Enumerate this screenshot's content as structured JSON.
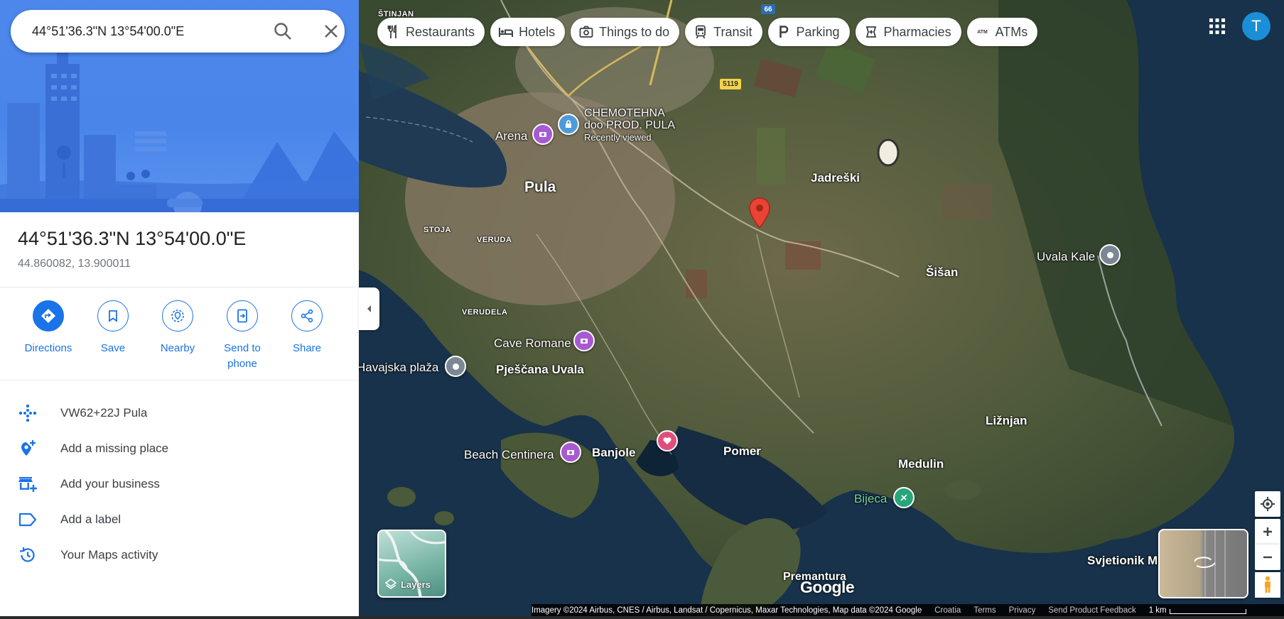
{
  "search": {
    "value": "44°51'36.3\"N 13°54'00.0\"E",
    "search_icon": "search-icon",
    "close_icon": "close-icon"
  },
  "place": {
    "title": "44°51'36.3\"N 13°54'00.0\"E",
    "coordinates": "44.860082, 13.900011"
  },
  "actions": [
    {
      "label": "Directions",
      "icon": "directions-icon"
    },
    {
      "label": "Save",
      "icon": "bookmark-icon"
    },
    {
      "label": "Nearby",
      "icon": "nearby-icon"
    },
    {
      "label": "Send to phone",
      "icon": "send-to-phone-icon"
    },
    {
      "label": "Share",
      "icon": "share-icon"
    }
  ],
  "list": [
    {
      "label": "VW62+22J Pula",
      "icon": "plus-code-icon"
    },
    {
      "label": "Add a missing place",
      "icon": "add-location-icon"
    },
    {
      "label": "Add your business",
      "icon": "add-business-icon"
    },
    {
      "label": "Add a label",
      "icon": "label-icon"
    },
    {
      "label": "Your Maps activity",
      "icon": "history-icon"
    }
  ],
  "chips": [
    "Restaurants",
    "Hotels",
    "Things to do",
    "Transit",
    "Parking",
    "Pharmacies",
    "ATMs"
  ],
  "avatar_letter": "T",
  "map_labels": {
    "stinjan": "ŠTINJAN",
    "road_66": "66",
    "road_5119": "5119",
    "chemotehna_1": "CHEMOTEHNA",
    "chemotehna_2": "doo PROD. PULA",
    "recently_viewed": "Recently viewed",
    "arena": "Arena",
    "pula": "Pula",
    "jadreski": "Jadreški",
    "stoja": "STOJA",
    "veruda": "VERUDA",
    "sisan": "Šišan",
    "uvala_kale": "Uvala Kale",
    "verudela": "VERUDELA",
    "cave_romane": "Cave Romane",
    "havajska": "Havajska plaža",
    "pjescana": "Pješčana Uvala",
    "liznjan": "Ližnjan",
    "beach_centinera": "Beach Centinera",
    "banjole": "Banjole",
    "pomer": "Pomer",
    "medulin": "Medulin",
    "bijeca": "Bijeca",
    "svjetionik": "Svjetionik M",
    "premantura": "Premantura"
  },
  "layers_label": "Layers",
  "google_logo": "Google",
  "footer": {
    "imagery": "Imagery ©2024 Airbus, CNES / Airbus, Landsat / Copernicus, Maxar Technologies, Map data ©2024 Google",
    "country": "Croatia",
    "terms": "Terms",
    "privacy": "Privacy",
    "feedback": "Send Product Feedback",
    "scale": "1 km"
  },
  "colors": {
    "accent": "#1a73e8",
    "pin": "#ea4335",
    "poi_purple": "#a75ad2",
    "poi_blue": "#4f9bd8",
    "poi_gray": "#7c8793",
    "poi_pink": "#e04f7b",
    "poi_green": "#28a57b"
  }
}
